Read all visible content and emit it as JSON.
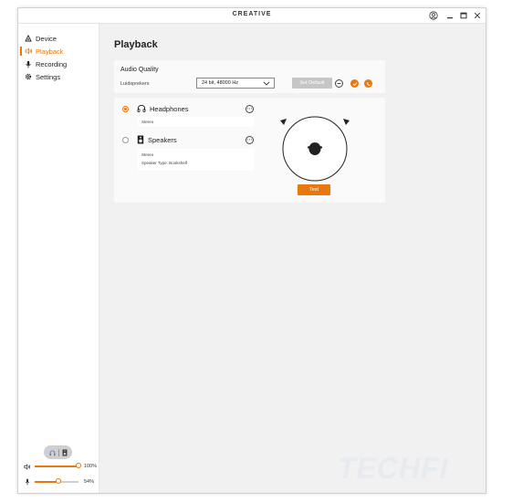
{
  "app": {
    "brand": "CREATIVE"
  },
  "sidebar": {
    "items": [
      {
        "label": "Device",
        "icon": "device-icon",
        "active": false
      },
      {
        "label": "Playback",
        "icon": "speaker-icon",
        "active": true
      },
      {
        "label": "Recording",
        "icon": "microphone-icon",
        "active": false
      },
      {
        "label": "Settings",
        "icon": "gear-icon",
        "active": false
      }
    ],
    "output_volume": {
      "value": "100%",
      "level": 1.0
    },
    "mic_volume": {
      "value": "54%",
      "level": 0.54
    }
  },
  "page": {
    "title": "Playback"
  },
  "audio_quality": {
    "title": "Audio Quality",
    "device_label": "Luidsprekers",
    "format_value": "24 bit, 48000 Hz",
    "set_default_label": "Set Default"
  },
  "devices": [
    {
      "name": "Headphones",
      "selected": true,
      "details": [
        "Stereo"
      ]
    },
    {
      "name": "Speakers",
      "selected": false,
      "details": [
        "Stereo",
        "Speaker Type: Bookshelf"
      ]
    }
  ],
  "test": {
    "label": "Test"
  },
  "watermark": "TECHFI",
  "colors": {
    "accent": "#e8780d",
    "background": "#f1f1f1",
    "panel": "#fafafa"
  }
}
